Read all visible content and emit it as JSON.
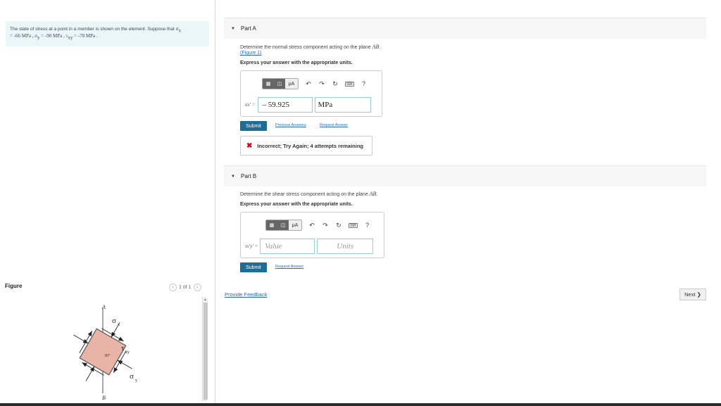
{
  "problem": {
    "intro": "The state of stress at a point in a member is shown on the element. Suppose that σ",
    "intro_sub": "x",
    "line2": "= -66 MPa , σ",
    "line2_sub": "y",
    "line2b": " = -90 MPa , τ",
    "line2b_sub": "xy",
    "line2c": " = -78 MPa ."
  },
  "figure": {
    "label": "Figure",
    "page": "1 of 1",
    "prev_icon": "chevron-left-icon",
    "next_icon": "chevron-right-icon",
    "labels": {
      "a": "A",
      "b": "B",
      "sigma_x": "σ",
      "sigma_x_sub": "x",
      "sigma_y": "σ",
      "sigma_y_sub": "y",
      "tau": "τ",
      "tau_sub": "xy",
      "angle": "30°"
    }
  },
  "partA": {
    "title": "Part A",
    "question": "Determine the normal stress component acting on the plane ",
    "question_math": "AB",
    "question_end": ".",
    "figure_link": "(Figure 1)",
    "express": "Express your answer with the appropriate units.",
    "toolbar": {
      "mu": "μA",
      "help": "?"
    },
    "eq_label": "σx' =",
    "value": "– 59.925",
    "units": "MPa",
    "submit": "Submit",
    "previous_answers": "Previous Answers",
    "request_answer": "Request Answer",
    "feedback": "Incorrect; Try Again; 4 attempts remaining"
  },
  "partB": {
    "title": "Part B",
    "question": "Determine the shear stress component acting on the plane ",
    "question_math": "AB",
    "question_end": ".",
    "express": "Express your answer with the appropriate units.",
    "toolbar": {
      "mu": "μA",
      "help": "?"
    },
    "eq_label": "τx'y' =",
    "value_placeholder": "Value",
    "units_placeholder": "Units",
    "submit": "Submit",
    "request_answer": "Request Answer"
  },
  "footer": {
    "provide_feedback": "Provide Feedback",
    "next": "Next"
  },
  "colors": {
    "accent": "#1d6e97",
    "link": "#2a6ebb",
    "error": "#d0021b",
    "element_fill": "#e8b4a8"
  }
}
